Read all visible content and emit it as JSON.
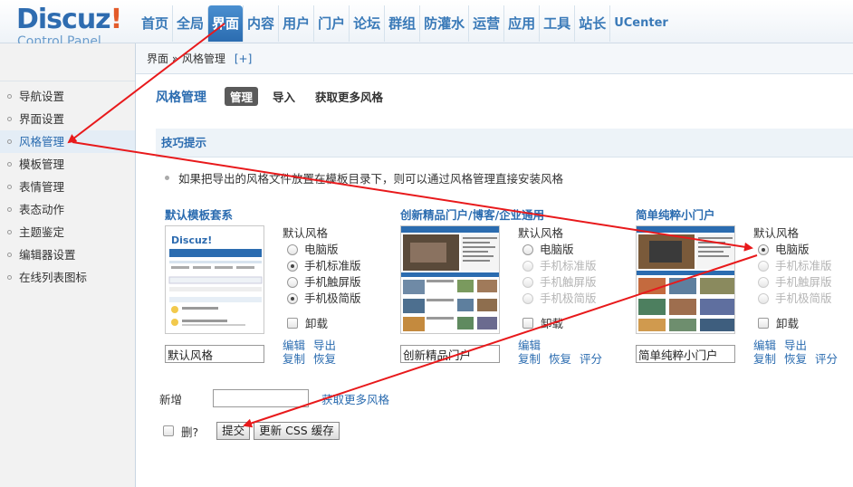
{
  "header": {
    "logo_main": "Discuz",
    "logo_bang": "!",
    "logo_sub": "Control Panel",
    "nav": [
      {
        "label": "首页"
      },
      {
        "label": "全局"
      },
      {
        "label": "界面",
        "active": true
      },
      {
        "label": "内容"
      },
      {
        "label": "用户"
      },
      {
        "label": "门户"
      },
      {
        "label": "论坛"
      },
      {
        "label": "群组"
      },
      {
        "label": "防灌水"
      },
      {
        "label": "运营"
      },
      {
        "label": "应用"
      },
      {
        "label": "工具"
      },
      {
        "label": "站长"
      },
      {
        "label": "UCenter"
      }
    ]
  },
  "breadcrumb": {
    "root": "界面",
    "sep": "»",
    "current": "风格管理",
    "add": "[+]"
  },
  "sidebar": {
    "items": [
      {
        "label": "导航设置"
      },
      {
        "label": "界面设置"
      },
      {
        "label": "风格管理",
        "active": true
      },
      {
        "label": "模板管理"
      },
      {
        "label": "表情管理"
      },
      {
        "label": "表态动作"
      },
      {
        "label": "主题鉴定"
      },
      {
        "label": "编辑器设置"
      },
      {
        "label": "在线列表图标"
      }
    ]
  },
  "main": {
    "title": "风格管理",
    "tabs": [
      "管理",
      "导入",
      "获取更多风格"
    ],
    "tips_title": "技巧提示",
    "tip": "如果把导出的风格文件放置在模板目录下，则可以通过风格管理直接安装风格",
    "default_label": "默认风格",
    "option_labels": [
      "电脑版",
      "手机标准版",
      "手机触屏版",
      "手机极简版"
    ],
    "uninstall": "卸载",
    "styles": [
      {
        "name": "默认模板套系",
        "input": "默认风格",
        "links": [
          "编辑",
          "导出",
          "复制",
          "恢复"
        ]
      },
      {
        "name": "创新精品门户/博客/企业通用",
        "input": "创新精品门户",
        "links": [
          "编辑",
          "复制",
          "恢复",
          "评分"
        ]
      },
      {
        "name": "简单纯粹小门户",
        "input": "简单纯粹小门户",
        "links": [
          "编辑",
          "导出",
          "复制",
          "恢复",
          "评分"
        ]
      }
    ],
    "add_label": "新增",
    "add_more": "获取更多风格",
    "delete_label": "删?",
    "submit": "提交",
    "update_css": "更新 CSS 缓存"
  },
  "thumbs": {
    "t1_brand": "Discuz!"
  },
  "colors": {
    "accent": "#2b6cb0",
    "arrow": "#e8191b",
    "nav_active": "#2b6cb0"
  }
}
